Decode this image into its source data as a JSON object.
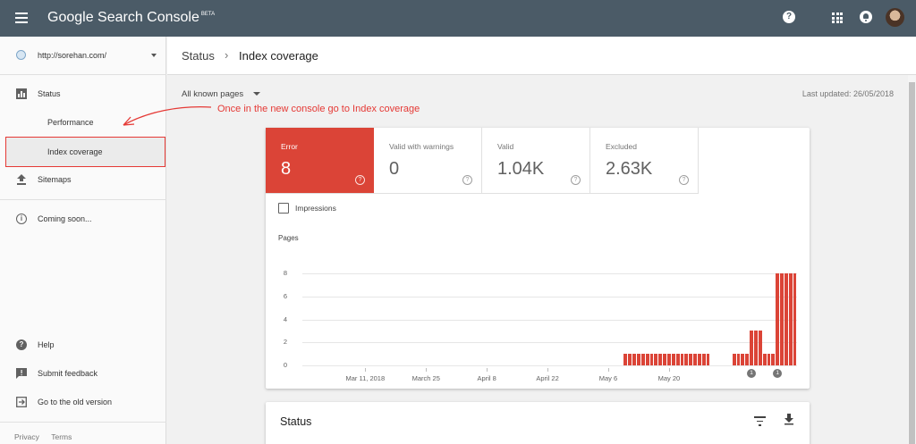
{
  "topbar": {
    "product": "Google Search Console",
    "beta": "BETA",
    "icons": [
      "menu-icon",
      "help-icon",
      "apps-icon",
      "notifications-icon",
      "avatar"
    ]
  },
  "sidebar": {
    "property": "http://sorehan.com/",
    "items": [
      {
        "label": "Status",
        "icon": "bar-chart-icon"
      },
      {
        "label": "Performance"
      },
      {
        "label": "Index coverage",
        "selected": true
      },
      {
        "label": "Sitemaps",
        "icon": "upload-icon"
      },
      {
        "label": "Coming soon...",
        "icon": "info-icon"
      }
    ],
    "bottom": [
      {
        "label": "Help",
        "icon": "help-icon"
      },
      {
        "label": "Submit feedback",
        "icon": "feedback-icon"
      },
      {
        "label": "Go to the old version",
        "icon": "exit-icon"
      }
    ],
    "footer": {
      "privacy": "Privacy",
      "terms": "Terms"
    }
  },
  "breadcrumb": {
    "parent": "Status",
    "current": "Index coverage"
  },
  "filter": {
    "label": "All known pages"
  },
  "last_updated": "Last updated: 26/05/2018",
  "annotation": "Once in the new console go to Index coverage",
  "tiles": [
    {
      "label": "Error",
      "value": "8",
      "active": true
    },
    {
      "label": "Valid with warnings",
      "value": "0"
    },
    {
      "label": "Valid",
      "value": "1.04K"
    },
    {
      "label": "Excluded",
      "value": "2.63K"
    }
  ],
  "impressions_label": "Impressions",
  "status_card": {
    "title": "Status"
  },
  "colors": {
    "error": "#db4437",
    "topbar": "#4b5b67"
  },
  "chart_data": {
    "type": "bar",
    "ylabel": "Pages",
    "ylim": [
      0,
      8
    ],
    "yticks": [
      0,
      2,
      4,
      6,
      8
    ],
    "x_ticks": [
      "Mar 11, 2018",
      "March 25",
      "April 8",
      "April 22",
      "May 6",
      "May 20"
    ],
    "annotation_markers": [
      "1",
      "1"
    ],
    "series": [
      {
        "color": "#db4437",
        "values": [
          0,
          0,
          0,
          0,
          0,
          0,
          0,
          0,
          0,
          0,
          0,
          0,
          0,
          0,
          0,
          0,
          0,
          0,
          0,
          0,
          0,
          0,
          0,
          0,
          0,
          0,
          0,
          0,
          0,
          0,
          0,
          0,
          0,
          0,
          0,
          0,
          0,
          0,
          0,
          0,
          0,
          0,
          0,
          0,
          0,
          0,
          0,
          0,
          0,
          0,
          0,
          0,
          0,
          0,
          0,
          0,
          0,
          0,
          0,
          0,
          0,
          0,
          0,
          0,
          0,
          0,
          0,
          0,
          0,
          0,
          0,
          0,
          0,
          0,
          1,
          1,
          1,
          1,
          1,
          1,
          1,
          1,
          1,
          1,
          1,
          1,
          1,
          1,
          1,
          1,
          1,
          1,
          1,
          1,
          0,
          0,
          0,
          0,
          0,
          1,
          1,
          1,
          1,
          3,
          3,
          3,
          1,
          1,
          1,
          8,
          8,
          8,
          8,
          8
        ]
      }
    ]
  }
}
